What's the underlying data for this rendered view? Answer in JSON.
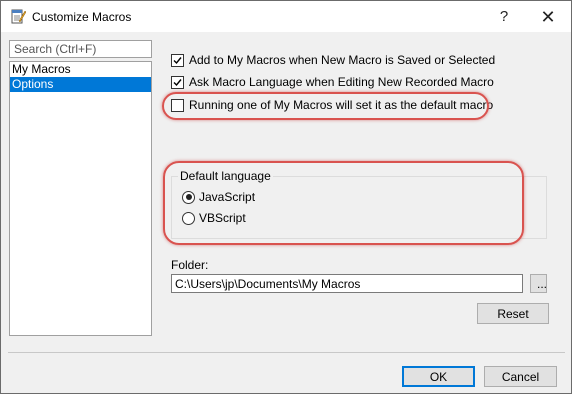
{
  "window": {
    "title": "Customize Macros",
    "help_glyph": "?",
    "close_glyph": "✕"
  },
  "sidebar": {
    "search_placeholder": "Search (Ctrl+F)",
    "items": [
      {
        "label": "My Macros",
        "selected": false
      },
      {
        "label": "Options",
        "selected": true
      }
    ]
  },
  "options": {
    "add_to_my_macros": {
      "label": "Add to My Macros when New Macro is Saved or Selected",
      "checked": true
    },
    "ask_macro_language": {
      "label": "Ask Macro Language when Editing New Recorded Macro",
      "checked": true
    },
    "running_sets_default": {
      "label": "Running one of My Macros will set it as the default macro",
      "checked": false
    }
  },
  "default_language": {
    "title": "Default language",
    "options": [
      {
        "label": "JavaScript",
        "selected": true
      },
      {
        "label": "VBScript",
        "selected": false
      }
    ]
  },
  "folder": {
    "label": "Folder:",
    "value": "C:\\Users\\jp\\Documents\\My Macros",
    "browse_label": "..."
  },
  "buttons": {
    "reset": "Reset",
    "ok": "OK",
    "cancel": "Cancel"
  },
  "colors": {
    "selection": "#0078d7",
    "annotation": "#d9534f"
  }
}
